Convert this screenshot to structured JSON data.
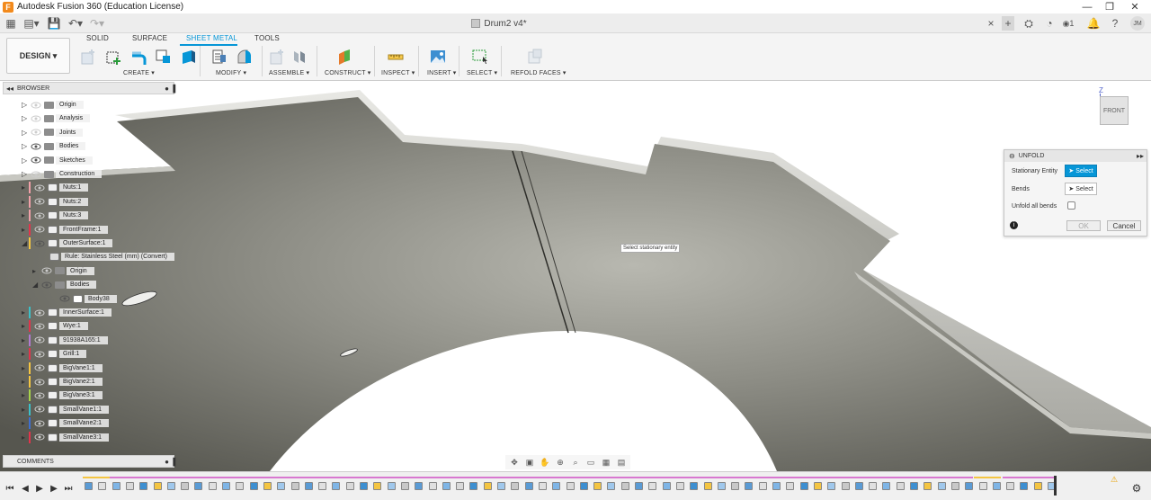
{
  "window": {
    "title": "Autodesk Fusion 360 (Education License)",
    "app_icon": "F",
    "controls": [
      "—",
      "❐",
      "✕"
    ]
  },
  "appbar": {
    "doc_title": "Drum2 v4*",
    "close_tab": "×",
    "add_tab": "+",
    "job_count": "1",
    "user": "JM"
  },
  "toolbar": {
    "workspace": "DESIGN ▾",
    "tabs": [
      "SOLID",
      "SURFACE",
      "SHEET METAL",
      "TOOLS"
    ],
    "active_tab": "SHEET METAL",
    "groups": [
      "CREATE ▾",
      "MODIFY ▾",
      "ASSEMBLE ▾",
      "CONSTRUCT ▾",
      "INSPECT ▾",
      "INSERT ▾",
      "SELECT ▾",
      "REFOLD FACES ▾"
    ]
  },
  "browser": {
    "title": "BROWSER",
    "items": [
      {
        "label": "Origin",
        "type": "folder",
        "eye": false,
        "color": ""
      },
      {
        "label": "Analysis",
        "type": "folder",
        "eye": false,
        "color": ""
      },
      {
        "label": "Joints",
        "type": "folder",
        "eye": false,
        "color": ""
      },
      {
        "label": "Bodies",
        "type": "folder",
        "eye": true,
        "color": ""
      },
      {
        "label": "Sketches",
        "type": "folder",
        "eye": true,
        "color": ""
      },
      {
        "label": "Construction",
        "type": "folder",
        "eye": false,
        "color": ""
      },
      {
        "label": "Nuts:1",
        "type": "comp",
        "eye": false,
        "color": "#f0a0a8"
      },
      {
        "label": "Nuts:2",
        "type": "comp",
        "eye": false,
        "color": "#f0a0a8"
      },
      {
        "label": "Nuts:3",
        "type": "comp",
        "eye": false,
        "color": "#f0a0a8"
      },
      {
        "label": "FrontFrame:1",
        "type": "comp",
        "eye": false,
        "color": "#e2344c"
      },
      {
        "label": "OuterSurface:1",
        "type": "comp",
        "eye": true,
        "color": "#f4c542"
      },
      {
        "label": "Rule: Stainless Steel (mm) (Convert)",
        "type": "rule",
        "eye": false,
        "color": ""
      },
      {
        "label": "Origin",
        "type": "folder",
        "eye": false,
        "color": ""
      },
      {
        "label": "Bodies",
        "type": "folder",
        "eye": true,
        "color": ""
      },
      {
        "label": "Body38",
        "type": "body",
        "eye": true,
        "color": ""
      },
      {
        "label": "InnerSurface:1",
        "type": "comp",
        "eye": false,
        "color": "#3cc0c8"
      },
      {
        "label": "Wye:1",
        "type": "comp",
        "eye": false,
        "color": "#e2344c"
      },
      {
        "label": "91938A165:1",
        "type": "comp",
        "eye": false,
        "color": "#b07ad0"
      },
      {
        "label": "Grill:1",
        "type": "comp",
        "eye": false,
        "color": "#e2344c"
      },
      {
        "label": "BigVane1:1",
        "type": "comp",
        "eye": false,
        "color": "#f4c542"
      },
      {
        "label": "BigVane2:1",
        "type": "comp",
        "eye": false,
        "color": "#f4c542"
      },
      {
        "label": "BigVane3:1",
        "type": "comp",
        "eye": false,
        "color": "#a7d24a"
      },
      {
        "label": "SmallVane1:1",
        "type": "comp",
        "eye": false,
        "color": "#3cc0c8"
      },
      {
        "label": "SmallVane2:1",
        "type": "comp",
        "eye": false,
        "color": "#3e6fd0"
      },
      {
        "label": "SmallVane3:1",
        "type": "comp",
        "eye": false,
        "color": "#e2344c"
      }
    ],
    "comments": "COMMENTS"
  },
  "unfold_panel": {
    "title": "UNFOLD",
    "stationary_label": "Stationary Entity",
    "stationary_value": "Select",
    "bends_label": "Bends",
    "bends_value": "Select",
    "unfold_all_label": "Unfold all bends",
    "ok": "OK",
    "cancel": "Cancel"
  },
  "viewport": {
    "tooltip": "Select stationary entity",
    "viewcube_face": "FRONT",
    "axis_label": "Z"
  }
}
